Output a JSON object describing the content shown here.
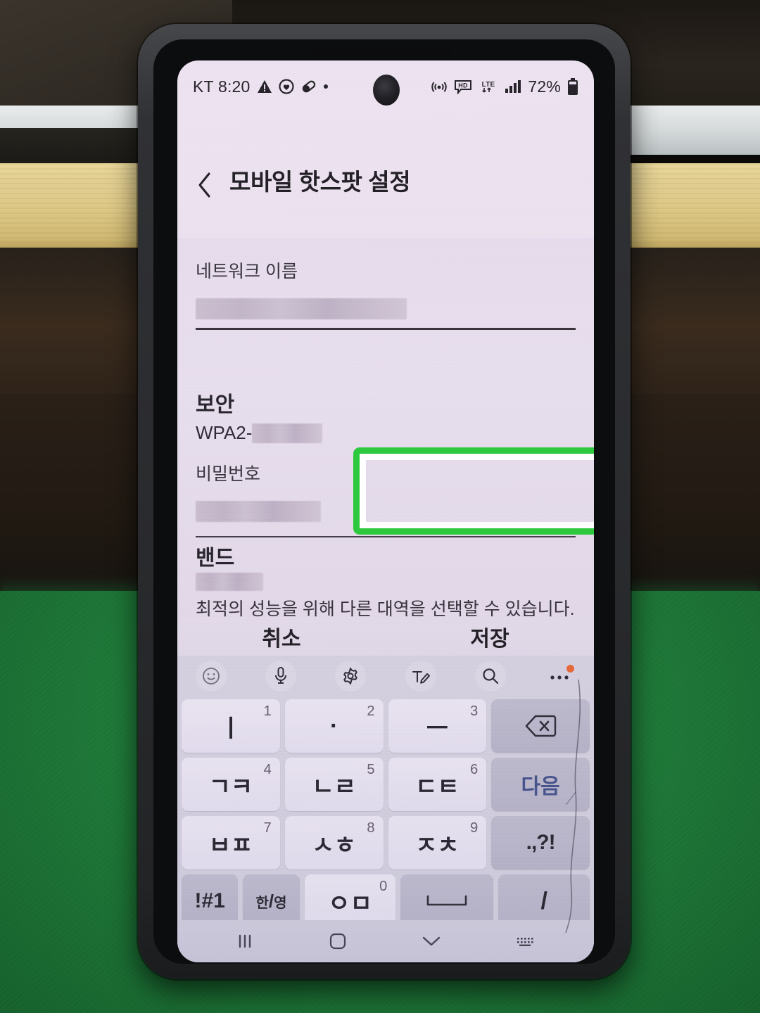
{
  "scene": {
    "description": "photo of smartphone on green felt, wooden shelf behind",
    "felt_color": "#1e7a38",
    "wood_color": "#ddc886",
    "highlight_color": "#2ec83f"
  },
  "status_bar": {
    "carrier_time": "KT 8:20",
    "left_icons": [
      "warning-triangle-icon",
      "heart-circle-icon",
      "capsule-icon",
      "dot-icon"
    ],
    "right_icons": [
      "hotspot-icon",
      "hd-voice-icon",
      "lte-icon",
      "signal-bars-icon"
    ],
    "battery_percent": "72%",
    "battery_icon": "battery-icon"
  },
  "app_bar": {
    "back_icon": "back-chevron-icon",
    "title": "모바일 핫스팟 설정"
  },
  "form": {
    "network_name": {
      "label": "네트워크 이름",
      "value": "",
      "redacted": true
    },
    "security": {
      "label": "보안",
      "value_prefix": "WPA2-",
      "value_redacted": true
    },
    "password": {
      "label": "비밀번호",
      "value": "",
      "redacted": true,
      "highlighted": true
    },
    "band": {
      "label": "밴드",
      "value": "",
      "redacted": true,
      "description": "최적의 성능을 위해 다른 대역을 선택할 수 있습니다."
    }
  },
  "actions": {
    "cancel_label": "취소",
    "save_label": "저장"
  },
  "keyboard": {
    "toolbar": [
      {
        "name": "emoji-icon",
        "label": "emoji"
      },
      {
        "name": "mic-icon",
        "label": "voice input"
      },
      {
        "name": "gear-icon",
        "label": "settings"
      },
      {
        "name": "handwriting-icon",
        "label": "handwriting"
      },
      {
        "name": "search-icon",
        "label": "search"
      },
      {
        "name": "more-icon",
        "label": "more",
        "badge": true
      }
    ],
    "rows": [
      [
        {
          "main": "ㅣ",
          "sup": "1",
          "type": "letter"
        },
        {
          "main": "·",
          "sup": "2",
          "type": "letter"
        },
        {
          "main": "ㅡ",
          "sup": "3",
          "type": "letter"
        },
        {
          "main": "backspace-icon",
          "sup": "",
          "type": "fn-icon"
        }
      ],
      [
        {
          "main": "ㄱㅋ",
          "sup": "4",
          "type": "letter"
        },
        {
          "main": "ㄴㄹ",
          "sup": "5",
          "type": "letter"
        },
        {
          "main": "ㄷㅌ",
          "sup": "6",
          "type": "letter"
        },
        {
          "main": "다음",
          "sup": "",
          "type": "fn-blue"
        }
      ],
      [
        {
          "main": "ㅂㅍ",
          "sup": "7",
          "type": "letter"
        },
        {
          "main": "ㅅㅎ",
          "sup": "8",
          "type": "letter"
        },
        {
          "main": "ㅈㅊ",
          "sup": "9",
          "type": "letter"
        },
        {
          "main": ".,?!",
          "sup": "",
          "type": "fn-punct"
        }
      ],
      [
        {
          "main": "!#1",
          "sup": "",
          "type": "fn-narrow"
        },
        {
          "main": "한/영",
          "sup": "",
          "type": "fn-narrow-hanyeong"
        },
        {
          "main": "ㅇㅁ",
          "sup": "0",
          "type": "letter"
        },
        {
          "main": "space-icon",
          "sup": "",
          "type": "fn-icon"
        },
        {
          "main": "/",
          "sup": "",
          "type": "fn"
        }
      ]
    ]
  },
  "nav_bar": {
    "recents_icon": "recents-icon",
    "home_icon": "home-icon",
    "hide_keyboard_icon": "chevron-down-icon",
    "keyboard_switch_icon": "keyboard-switch-icon"
  }
}
